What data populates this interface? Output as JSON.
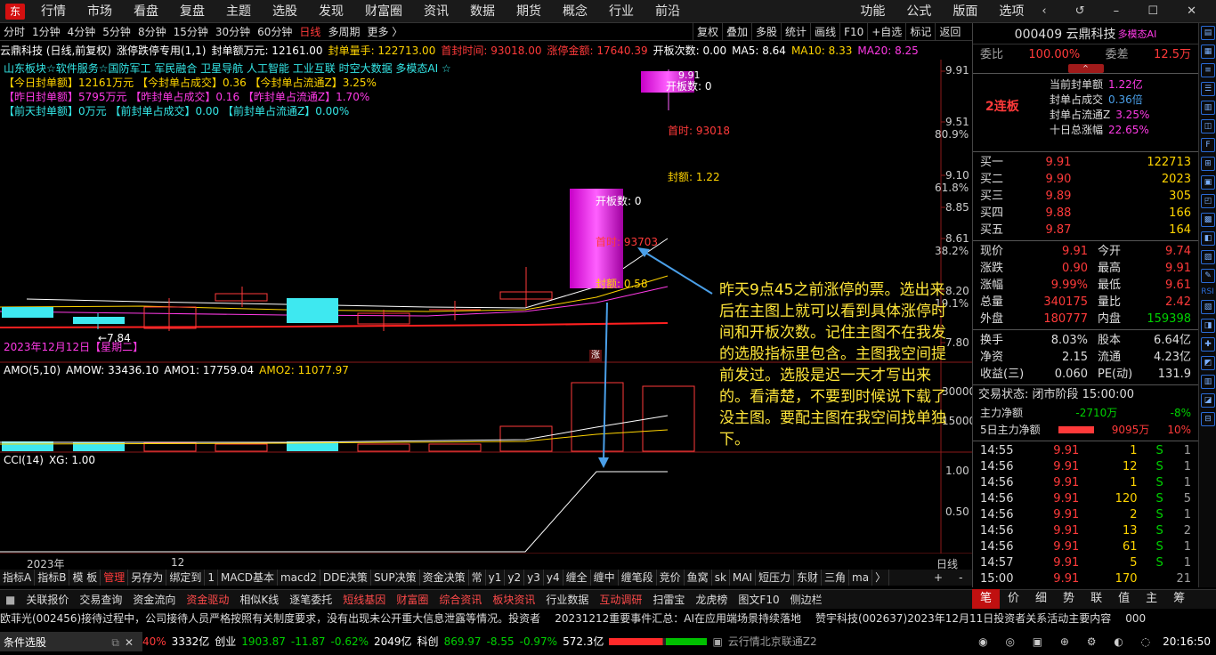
{
  "top_menu": {
    "items": [
      "行情",
      "市场",
      "看盘",
      "复盘",
      "主题",
      "选股",
      "发现",
      "财富圈",
      "资讯",
      "数据",
      "期货",
      "概念",
      "行业",
      "前沿"
    ],
    "right": [
      "功能",
      "公式",
      "版面",
      "选项"
    ]
  },
  "period_bar": {
    "items": [
      "分时",
      "1分钟",
      "4分钟",
      "5分钟",
      "8分钟",
      "15分钟",
      "30分钟",
      "60分钟",
      "日线",
      "多周期",
      "更多 〉"
    ],
    "active": "日线"
  },
  "toolbar": {
    "items": [
      "复权",
      "叠加",
      "多股",
      "统计",
      "画线",
      "F10",
      "标记",
      "返回"
    ],
    "add_label": "+自选"
  },
  "info_line": {
    "stock": "云鼎科技 (日线,前复权)",
    "indicator": "涨停跌停专用(1,1)",
    "fd_amount": "封单额万元: 12161.00",
    "fd_hand": "封单量手: 122713.00",
    "first_time": "首封时间: 93018.00",
    "limit_amount": "涨停金额: 17640.39",
    "open_count": "开板次数: 0.00",
    "ma5": "MA5: 8.64",
    "ma10": "MA10: 8.33",
    "ma20": "MA20: 8.25"
  },
  "concepts": "山东板块☆软件服务☆国防军工 军民融合 卫星导航 人工智能 工业互联 时空大数据 多模态AI ☆",
  "seal_lines": [
    "【今日封单额】12161万元 【今封单占成交】0.36 【今封单占流通Z】3.25%",
    "【昨日封单额】5795万元 【昨封单占成交】0.16 【昨封单占流通Z】1.70%",
    "【前天封单额】0万元 【前封单占成交】0.00 【前封单占流通Z】0.00%"
  ],
  "chart": {
    "price_labels": [
      "9.91",
      "9.51",
      "9.10",
      "8.85",
      "8.61",
      "8.20",
      "7.80"
    ],
    "pct_labels": [
      "80.9%",
      "61.8%",
      "38.2%",
      "19.1%"
    ],
    "annot_today": {
      "open": "开板数: 0",
      "first": "首时: 93018",
      "seal": "封额: 1.22",
      "top": "9.91"
    },
    "annot_yday": {
      "open": "开板数: 0",
      "first": "首时: 93703",
      "seal": "封额: 0.58"
    },
    "low_label": "7.84",
    "date_label": "2023年12月12日【星期二】",
    "limit_mark": "涨",
    "amo_title": "AMO(5,10)",
    "amow": "AMOW: 33436.10",
    "amo1": "AMO1: 17759.04",
    "amo2": "AMO2: 11077.97",
    "amo_labels": [
      "30000",
      "15000"
    ],
    "cci_title": "CCI(14)",
    "cci_xg": "XG: 1.00",
    "cci_labels": [
      "1.00",
      "0.50"
    ],
    "x_year": "2023年",
    "x_month": "12",
    "period": "日线"
  },
  "note": "昨天9点45之前涨停的票。选出来后在主图上就可以看到具体涨停时间和开板次数。记住主图不在我发的选股指标里包含。主图我空间提前发过。选股是迟一天才写出来的。看清楚，不要到时候说下载了没主图。要配主图在我空间找单独下。",
  "indicator_tabs": [
    "指标A",
    "指标B",
    "模 板",
    "管理",
    "另存为",
    "绑定到",
    "1",
    "MACD基本",
    "macd2",
    "DDE决策",
    "SUP决策",
    "资金决策",
    "常",
    "y1",
    "y2",
    "y3",
    "y4",
    "缠全",
    "缠中",
    "缠笔段",
    "竞价",
    "鱼窝",
    "sk",
    "MAI",
    "短压力",
    "东财",
    "三角",
    "ma",
    "〉"
  ],
  "func_bar": [
    "关联报价",
    "交易查询",
    "资金流向",
    "资金驱动",
    "相似K线",
    "逐笔委托",
    "短线基因",
    "财富圈",
    "综合资讯",
    "板块资讯",
    "行业数据",
    "互动调研",
    "扫雷宝",
    "龙虎榜",
    "图文F10",
    "侧边栏"
  ],
  "right_tabs": [
    "笔",
    "价",
    "细",
    "势",
    "联",
    "值",
    "主",
    "筹"
  ],
  "news": [
    "欧菲光(002456)接待过程中，公司接待人员严格按照有关制度要求，没有出现未公开重大信息泄露等情况。投资者",
    "20231212重要事件汇总：AI在应用端场景持续落地",
    "赞宇科技(002637)2023年12月11日投资者关系活动主要内容",
    "000"
  ],
  "status": {
    "panel": "条件选股",
    "idx1_pct": "40%",
    "idx1_amt": "3332亿",
    "cyb": "创业",
    "cyb_val": "1903.87",
    "cyb_chg": "-11.87",
    "cyb_pct": "-0.62%",
    "cyb_amt": "2049亿",
    "kc": "科创",
    "kc_val": "869.97",
    "kc_chg": "-8.55",
    "kc_pct": "-0.97%",
    "kc_amt": "572.3亿",
    "server": "云行情北京联通Z2",
    "time": "20:16:50"
  },
  "quote": {
    "code_name": "000409 云鼎科技",
    "tag": "多模态AI",
    "weibi_label": "委比",
    "weibi": "100.00%",
    "weicha_label": "委差",
    "weicha": "12.5万",
    "board": "2连板",
    "seal_info": [
      [
        "当前封单额",
        "1.22亿"
      ],
      [
        "封单占成交",
        "0.36倍"
      ],
      [
        "封单占流通Z",
        "3.25%"
      ],
      [
        "十日总涨幅",
        "22.65%"
      ]
    ],
    "bids": [
      [
        "买一",
        "9.91",
        "122713"
      ],
      [
        "买二",
        "9.90",
        "2023"
      ],
      [
        "买三",
        "9.89",
        "305"
      ],
      [
        "买四",
        "9.88",
        "166"
      ],
      [
        "买五",
        "9.87",
        "164"
      ]
    ],
    "stats": [
      [
        "现价",
        "9.91",
        "今开",
        "9.74"
      ],
      [
        "涨跌",
        "0.90",
        "最高",
        "9.91"
      ],
      [
        "涨幅",
        "9.99%",
        "最低",
        "9.61"
      ],
      [
        "总量",
        "340175",
        "量比",
        "2.42"
      ],
      [
        "外盘",
        "180777",
        "内盘",
        "159398"
      ]
    ],
    "stats2": [
      [
        "换手",
        "8.03%",
        "股本",
        "6.64亿"
      ],
      [
        "净资",
        "2.15",
        "流通",
        "4.23亿"
      ],
      [
        "收益(三)",
        "0.060",
        "PE(动)",
        "131.9"
      ]
    ],
    "trade_state": "交易状态: 闭市阶段 15:00:00",
    "main_net_label": "主力净额",
    "main_net": "-2710万",
    "main_net_pct": "-8%",
    "main5_label": "5日主力净额",
    "main5": "9095万",
    "main5_pct": "10%",
    "ticks": [
      [
        "14:55",
        "9.91",
        "1",
        "S",
        "1"
      ],
      [
        "14:56",
        "9.91",
        "12",
        "S",
        "1"
      ],
      [
        "14:56",
        "9.91",
        "1",
        "S",
        "1"
      ],
      [
        "14:56",
        "9.91",
        "120",
        "S",
        "5"
      ],
      [
        "14:56",
        "9.91",
        "2",
        "S",
        "1"
      ],
      [
        "14:56",
        "9.91",
        "13",
        "S",
        "2"
      ],
      [
        "14:56",
        "9.91",
        "61",
        "S",
        "1"
      ],
      [
        "14:57",
        "9.91",
        "5",
        "S",
        "1"
      ],
      [
        "15:00",
        "9.91",
        "170",
        "",
        "21"
      ]
    ]
  },
  "side_icons": [
    "RSI",
    "F10"
  ]
}
